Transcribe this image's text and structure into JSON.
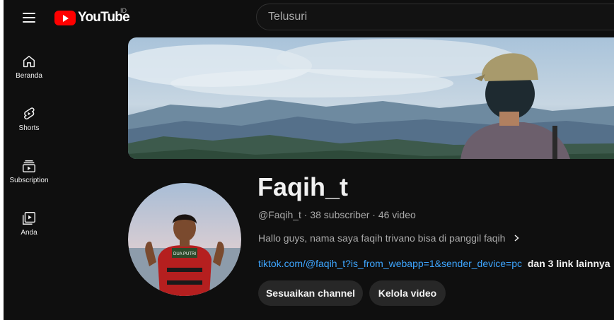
{
  "header": {
    "logo_text": "YouTube",
    "country_code": "ID",
    "search_placeholder": "Telusuri"
  },
  "sidebar": {
    "items": [
      {
        "label": "Beranda",
        "icon": "home-icon"
      },
      {
        "label": "Shorts",
        "icon": "shorts-icon"
      },
      {
        "label": "Subscription",
        "icon": "subscriptions-icon"
      },
      {
        "label": "Anda",
        "icon": "you-icon"
      }
    ]
  },
  "channel": {
    "name": "Faqih_t",
    "meta": "@Faqih_t · 38 subscriber · 46 video",
    "description": "Hallo guys, nama saya faqih trivano bisa di panggil faqih",
    "link_text": "tiktok.com/@faqih_t?is_from_webapp=1&sender_device=pc",
    "more_links": "dan 3 link lainnya",
    "avatar_shirt_text": "DUA PUTRI"
  },
  "actions": {
    "customize_label": "Sesuaikan channel",
    "manage_label": "Kelola video"
  },
  "colors": {
    "background": "#0f0f0f",
    "accent_red": "#ff0000",
    "link_blue": "#3ea6ff",
    "button_bg": "#272727"
  }
}
